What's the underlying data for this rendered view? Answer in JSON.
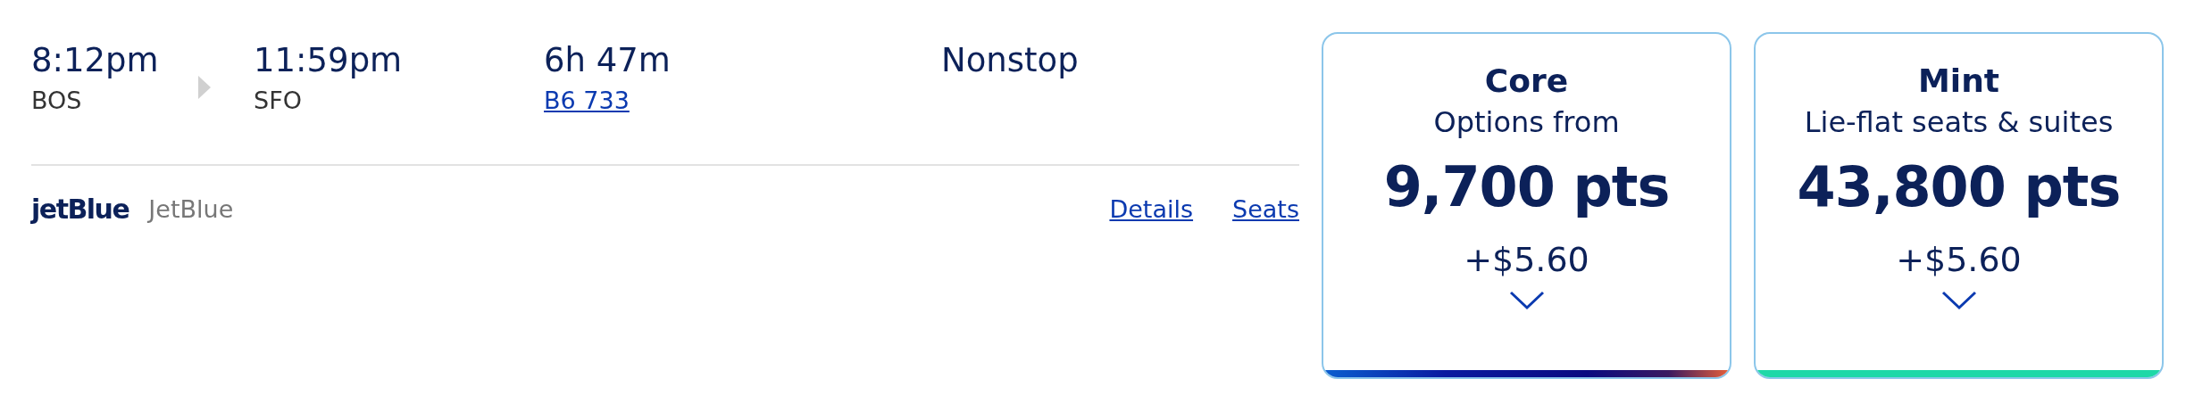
{
  "flight": {
    "depart_time": "8:12pm",
    "depart_airport": "BOS",
    "arrive_time": "11:59pm",
    "arrive_airport": "SFO",
    "duration": "6h 47m",
    "flight_number": "B6 733",
    "stops": "Nonstop"
  },
  "airline": {
    "logo": "jetBlue",
    "name": "JetBlue"
  },
  "links": [
    "Details",
    "Seats"
  ],
  "fares": [
    {
      "kind": "core",
      "cabin": "Core",
      "subtitle": "Options from",
      "points": "9,700 pts",
      "cash": "+$5.60"
    },
    {
      "kind": "mint",
      "cabin": "Mint",
      "subtitle": "Lie-flat seats & suites",
      "points": "43,800 pts",
      "cash": "+$5.60"
    }
  ]
}
